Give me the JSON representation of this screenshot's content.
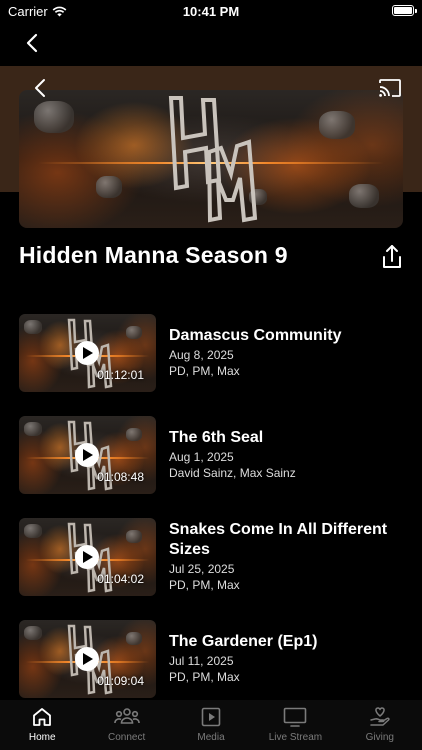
{
  "status": {
    "carrier": "Carrier",
    "time": "10:41 PM"
  },
  "page": {
    "title": "Hidden Manna Season 9"
  },
  "episodes": [
    {
      "title": "Damascus Community",
      "date": "Aug 8, 2025",
      "people": "PD, PM, Max",
      "duration": "01:12:01"
    },
    {
      "title": "The 6th Seal",
      "date": "Aug 1, 2025",
      "people": "David Sainz,  Max Sainz",
      "duration": "01:08:48"
    },
    {
      "title": "Snakes Come In All Different Sizes",
      "date": "Jul 25, 2025",
      "people": "PD, PM, Max",
      "duration": "01:04:02"
    },
    {
      "title": "The Gardener (Ep1)",
      "date": "Jul 11, 2025",
      "people": "PD, PM, Max",
      "duration": "01:09:04"
    }
  ],
  "tabs": [
    {
      "label": "Home",
      "icon": "home-icon",
      "active": true
    },
    {
      "label": "Connect",
      "icon": "people-icon",
      "active": false
    },
    {
      "label": "Media",
      "icon": "media-play-icon",
      "active": false
    },
    {
      "label": "Live Stream",
      "icon": "tv-icon",
      "active": false
    },
    {
      "label": "Giving",
      "icon": "giving-hand-heart-icon",
      "active": false
    }
  ],
  "colors": {
    "background": "#000000",
    "hero_band": "#3a2618",
    "tab_inactive": "#7b7b7b",
    "tab_active": "#ffffff"
  }
}
